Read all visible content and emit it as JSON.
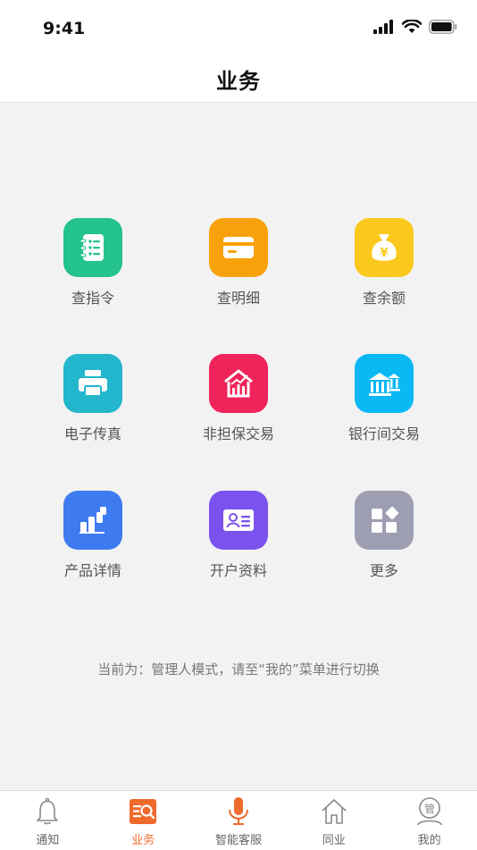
{
  "status": {
    "time": "9:41"
  },
  "header": {
    "title": "业务"
  },
  "grid": {
    "items": [
      {
        "label": "查指令",
        "icon": "notebook-icon",
        "color": "#23c28e"
      },
      {
        "label": "查明细",
        "icon": "card-icon",
        "color": "#f9a10a"
      },
      {
        "label": "查余额",
        "icon": "money-bag-icon",
        "color": "#fbc91d"
      },
      {
        "label": "电子传真",
        "icon": "fax-printer-icon",
        "color": "#23b6cc"
      },
      {
        "label": "非担保交易",
        "icon": "house-chart-icon",
        "color": "#f0245a"
      },
      {
        "label": "银行间交易",
        "icon": "banks-icon",
        "color": "#0ab8f3"
      },
      {
        "label": "产品详情",
        "icon": "product-chart-icon",
        "color": "#3f7bf0"
      },
      {
        "label": "开户资料",
        "icon": "id-card-icon",
        "color": "#7c52ee"
      },
      {
        "label": "更多",
        "icon": "more-grid-icon",
        "color": "#9e9eb2"
      }
    ]
  },
  "footer_tip": "当前为：管理人模式，请至“我的”菜单进行切换",
  "tabbar": {
    "tabs": [
      {
        "label": "通知",
        "icon": "bell-icon"
      },
      {
        "label": "业务",
        "icon": "business-search-icon",
        "active": true
      },
      {
        "label": "智能客服",
        "icon": "microphone-icon"
      },
      {
        "label": "同业",
        "icon": "home-icon"
      },
      {
        "label": "我的",
        "icon": "manager-avatar-icon"
      }
    ],
    "active_color": "#f06a2c"
  }
}
